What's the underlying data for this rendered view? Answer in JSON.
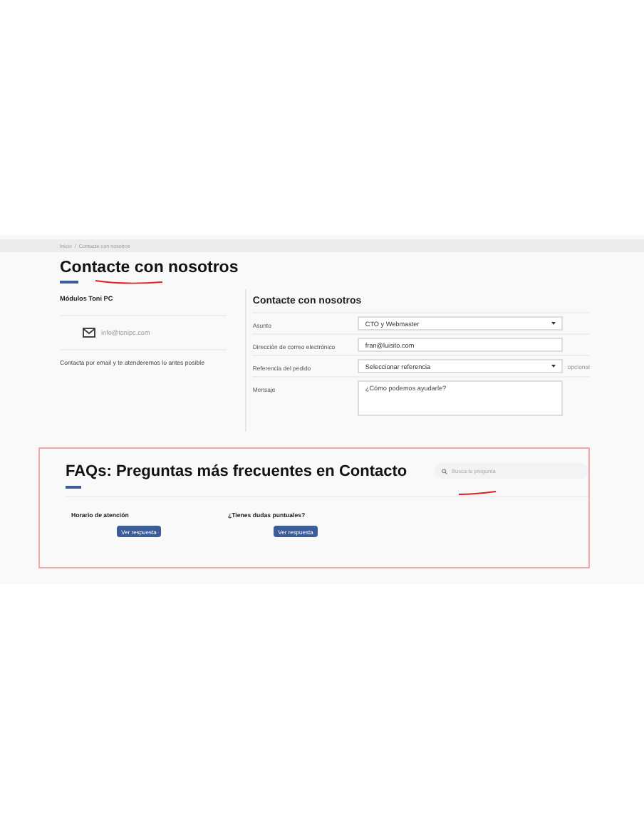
{
  "breadcrumb": {
    "separator": "/",
    "items": [
      {
        "label": "Inicio"
      },
      {
        "label": "Contacte con nosotros"
      }
    ]
  },
  "page_title": "Contacte con nosotros",
  "store": {
    "name": "Módulos Toni PC",
    "email": "info@tonipc.com",
    "note": "Contacta por email y te atenderemos lo antes posible"
  },
  "form": {
    "title": "Contacte con nosotros",
    "fields": [
      {
        "kind": "select",
        "label": "Asunto",
        "value": "CTO y Webmaster"
      },
      {
        "kind": "text",
        "label": "Dirección de correo electrónico",
        "value": "fran@luisito.com"
      },
      {
        "kind": "select",
        "label": "Referencia del pedido",
        "value": "Seleccionar referencia",
        "note": "opcional"
      },
      {
        "kind": "textarea",
        "label": "Mensaje",
        "placeholder": "¿Cómo podemos ayudarle?"
      }
    ]
  },
  "faq": {
    "title": "FAQs: Preguntas más frecuentes en Contacto",
    "search": {
      "placeholder": "Busca tu pregunta"
    },
    "items": [
      {
        "question": "Horario de atención",
        "button": "Ver respuesta"
      },
      {
        "question": "¿Tienes dudas puntuales?",
        "button": "Ver respuesta"
      }
    ]
  }
}
